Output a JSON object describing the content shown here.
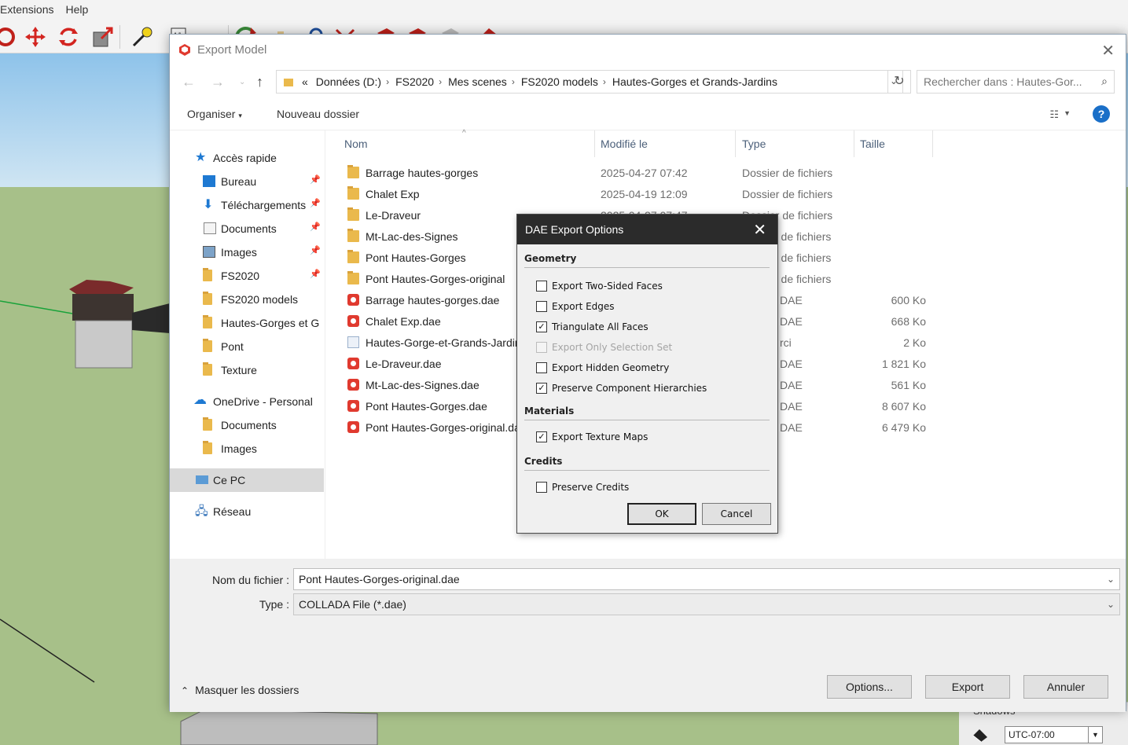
{
  "app": {
    "menu": [
      "Extensions",
      "Help"
    ],
    "timezone": "UTC-07:00",
    "shadows_label": "Shadows"
  },
  "dialog": {
    "title": "Export Model",
    "breadcrumb_prefix": "«",
    "breadcrumb": [
      "Données (D:)",
      "FS2020",
      "Mes scenes",
      "FS2020 models",
      "Hautes-Gorges et Grands-Jardins"
    ],
    "search_placeholder": "Rechercher dans : Hautes-Gor...",
    "organize_label": "Organiser",
    "new_folder_label": "Nouveau dossier",
    "help_label": "?",
    "nav": {
      "quick_access": "Accès rapide",
      "items": [
        "Bureau",
        "Téléchargements",
        "Documents",
        "Images",
        "FS2020",
        "FS2020 models",
        "Hautes-Gorges et G",
        "Pont",
        "Texture"
      ],
      "onedrive": "OneDrive - Personal",
      "onedrive_items": [
        "Documents",
        "Images"
      ],
      "this_pc": "Ce PC",
      "network": "Réseau"
    },
    "columns": [
      "Nom",
      "Modifié le",
      "Type",
      "Taille"
    ],
    "files": [
      {
        "name": "Barrage hautes-gorges",
        "date": "2025-04-27 07:42",
        "type": "Dossier de fichiers",
        "size": ""
      },
      {
        "name": "Chalet Exp",
        "date": "2025-04-19 12:09",
        "type": "Dossier de fichiers",
        "size": ""
      },
      {
        "name": "Le-Draveur",
        "date": "2025-04-27 07:47",
        "type": "Dossier de fichiers",
        "size": ""
      },
      {
        "name": "Mt-Lac-des-Signes",
        "date": "",
        "type": "r de fichiers",
        "size": ""
      },
      {
        "name": "Pont Hautes-Gorges",
        "date": "",
        "type": "r de fichiers",
        "size": ""
      },
      {
        "name": "Pont Hautes-Gorges-original",
        "date": "",
        "type": "r de fichiers",
        "size": ""
      },
      {
        "name": "Barrage hautes-gorges.dae",
        "date": "",
        "type": "DAE",
        "size": "600 Ko"
      },
      {
        "name": "Chalet Exp.dae",
        "date": "",
        "type": "DAE",
        "size": "668 Ko"
      },
      {
        "name": "Hautes-Gorge-et-Grands-Jardins",
        "date": "",
        "type": "rci",
        "size": "2 Ko"
      },
      {
        "name": "Le-Draveur.dae",
        "date": "",
        "type": "DAE",
        "size": "1 821 Ko"
      },
      {
        "name": "Mt-Lac-des-Signes.dae",
        "date": "",
        "type": "DAE",
        "size": "561 Ko"
      },
      {
        "name": "Pont Hautes-Gorges.dae",
        "date": "",
        "type": "DAE",
        "size": "8 607 Ko"
      },
      {
        "name": "Pont Hautes-Gorges-original.dae",
        "date": "",
        "type": "DAE",
        "size": "6 479 Ko"
      }
    ],
    "filename_label": "Nom du fichier :",
    "filename_value": "Pont Hautes-Gorges-original.dae",
    "type_label": "Type :",
    "type_value": "COLLADA File (*.dae)",
    "hide_folders": "Masquer les dossiers",
    "options_button": "Options...",
    "export_button": "Export",
    "cancel_button": "Annuler"
  },
  "dae": {
    "title": "DAE Export Options",
    "geometry": "Geometry",
    "materials": "Materials",
    "credits": "Credits",
    "options": [
      {
        "label": "Export Two-Sided Faces",
        "checked": false,
        "disabled": false
      },
      {
        "label": "Export Edges",
        "checked": false,
        "disabled": false
      },
      {
        "label": "Triangulate All Faces",
        "checked": true,
        "disabled": false
      },
      {
        "label": "Export Only Selection Set",
        "checked": false,
        "disabled": true
      },
      {
        "label": "Export Hidden Geometry",
        "checked": false,
        "disabled": false
      },
      {
        "label": "Preserve Component Hierarchies",
        "checked": true,
        "disabled": false
      },
      {
        "label": "Export Texture Maps",
        "checked": true,
        "disabled": false
      },
      {
        "label": "Preserve Credits",
        "checked": false,
        "disabled": false
      }
    ],
    "ok": "OK",
    "cancel": "Cancel"
  }
}
